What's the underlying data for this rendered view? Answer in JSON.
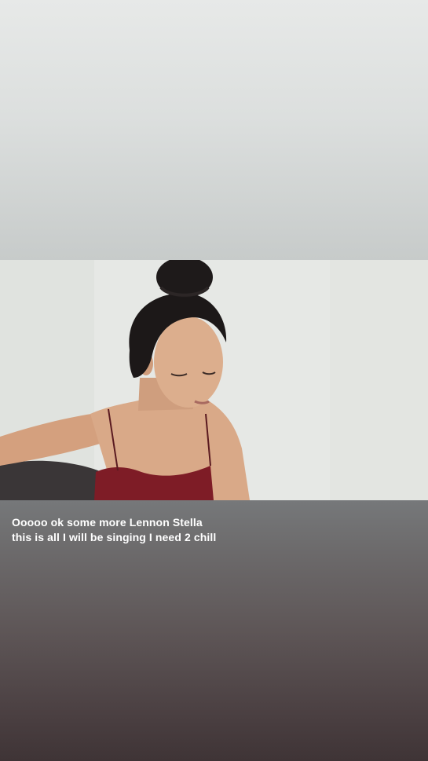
{
  "story": {
    "caption": "Ooooo ok some more Lennon Stella this is all I will be singing I need 2 chill"
  },
  "colors": {
    "top_background": "#dcdfde",
    "bottom_background": "#4c4143",
    "caption_text": "#ffffff",
    "top_red": "#7e1c26"
  }
}
